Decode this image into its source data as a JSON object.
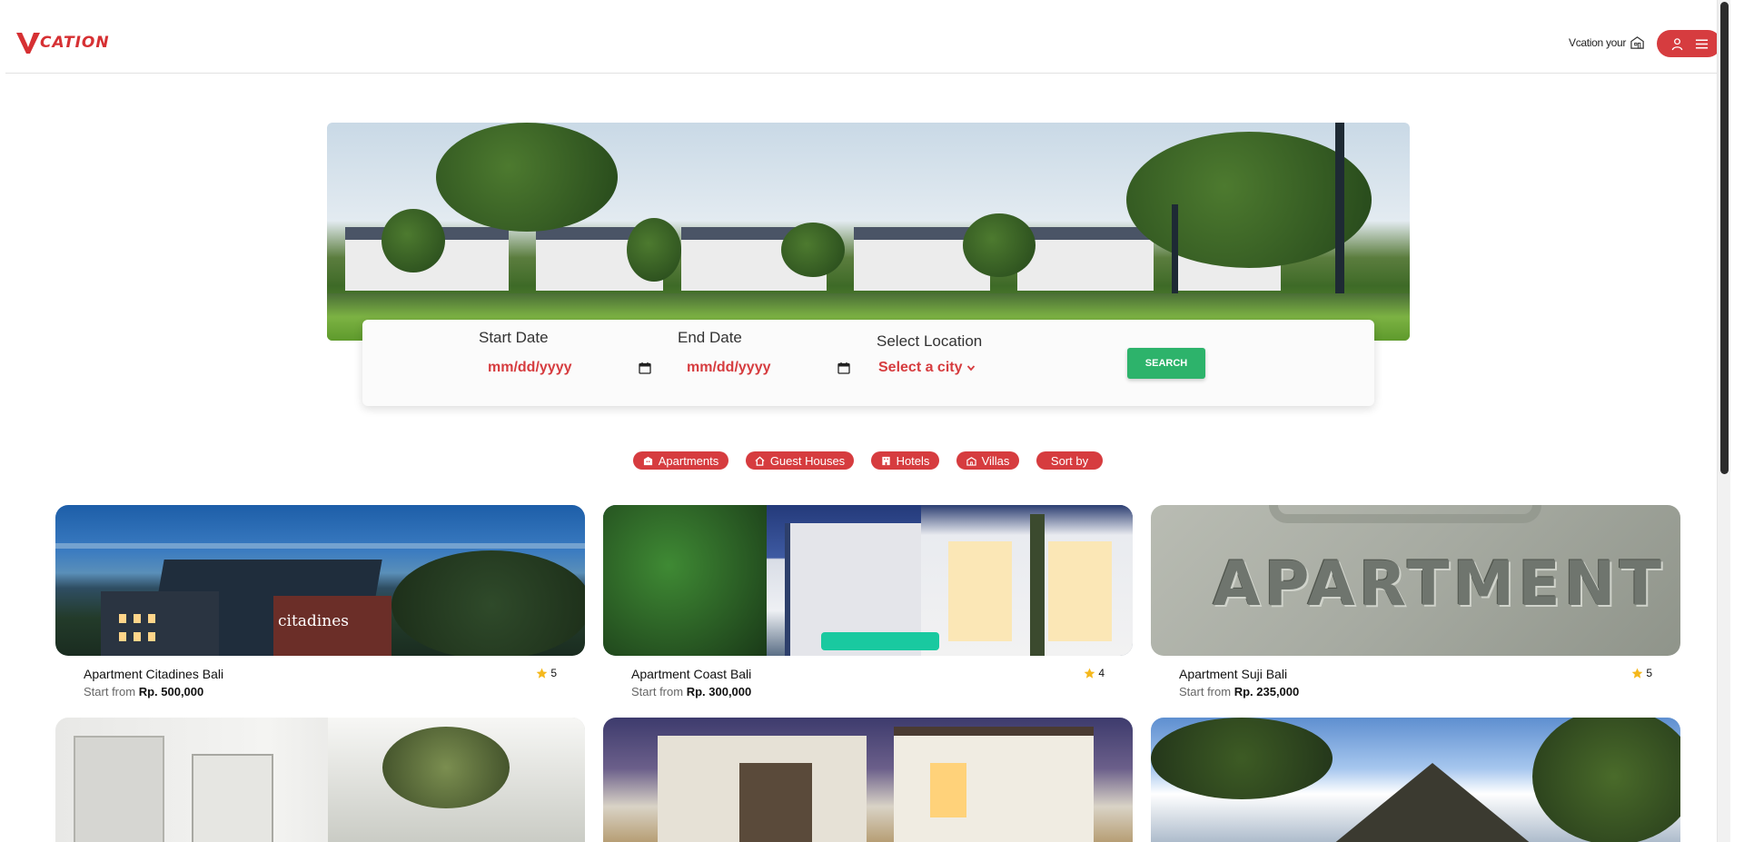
{
  "header": {
    "logo_text": "CATION",
    "host_link": "Vcation your",
    "icons": {
      "host": "home-icon",
      "user": "user-icon",
      "menu": "hamburger-menu-icon"
    }
  },
  "search": {
    "start_label": "Start Date",
    "start_placeholder": "mm/dd/yyyy",
    "end_label": "End Date",
    "end_placeholder": "mm/dd/yyyy",
    "location_label": "Select Location",
    "location_value": "Select a city",
    "search_button": "SEARCH"
  },
  "filters": [
    {
      "label": "Apartments",
      "icon": "apartment-icon"
    },
    {
      "label": "Guest Houses",
      "icon": "house-icon"
    },
    {
      "label": "Hotels",
      "icon": "hotel-icon"
    },
    {
      "label": "Villas",
      "icon": "villa-icon"
    },
    {
      "label": "Sort by",
      "icon": ""
    }
  ],
  "listings": [
    {
      "title": "Apartment Citadines Bali",
      "rating": "5",
      "price_prefix": "Start from",
      "price": "Rp. 500,000",
      "image_text": "citadines"
    },
    {
      "title": "Apartment Coast Bali",
      "rating": "4",
      "price_prefix": "Start from",
      "price": "Rp. 300,000",
      "image_text": ""
    },
    {
      "title": "Apartment Suji Bali",
      "rating": "5",
      "price_prefix": "Start from",
      "price": "Rp. 235,000",
      "image_text": "APARTMENT"
    }
  ],
  "colors": {
    "brand": "#d63c3f",
    "search_button": "#2db36b",
    "star": "#f5b81c"
  }
}
